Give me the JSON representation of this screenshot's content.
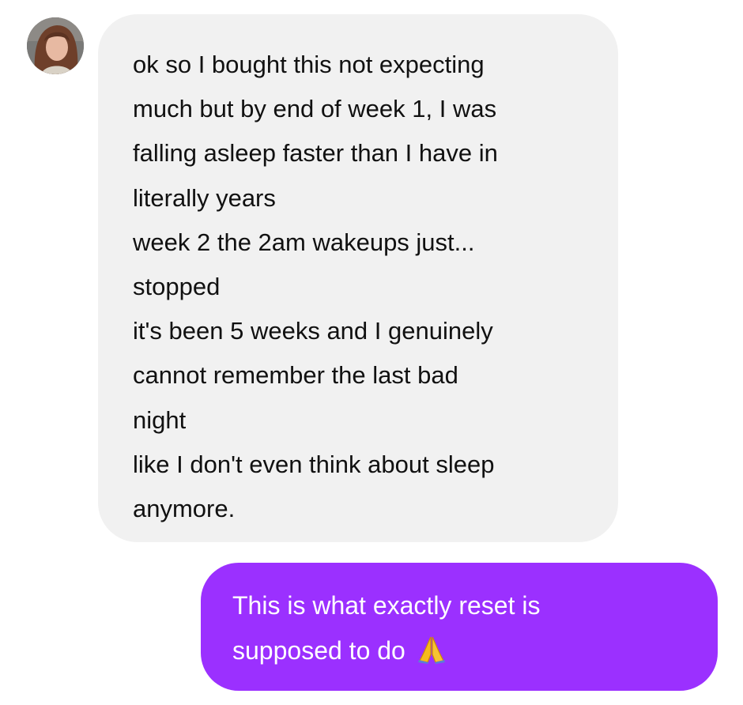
{
  "incoming_message": {
    "lines": [
      "ok so I bought this not expecting",
      "much but by end of week 1, I was",
      "falling asleep faster than I have in",
      "literally years",
      "week 2 the 2am wakeups just...",
      "stopped",
      "it's been 5 weeks and I genuinely",
      "cannot remember the last bad",
      "night",
      "like I don't even think about sleep",
      "anymore."
    ],
    "bubble_color": "#f1f1f1"
  },
  "outgoing_message": {
    "lines": [
      "This is what exactly reset is",
      "supposed to do"
    ],
    "emoji": "folded-hands-icon",
    "bubble_color": "#9b30ff"
  },
  "avatar": {
    "icon": "user-photo-avatar"
  }
}
